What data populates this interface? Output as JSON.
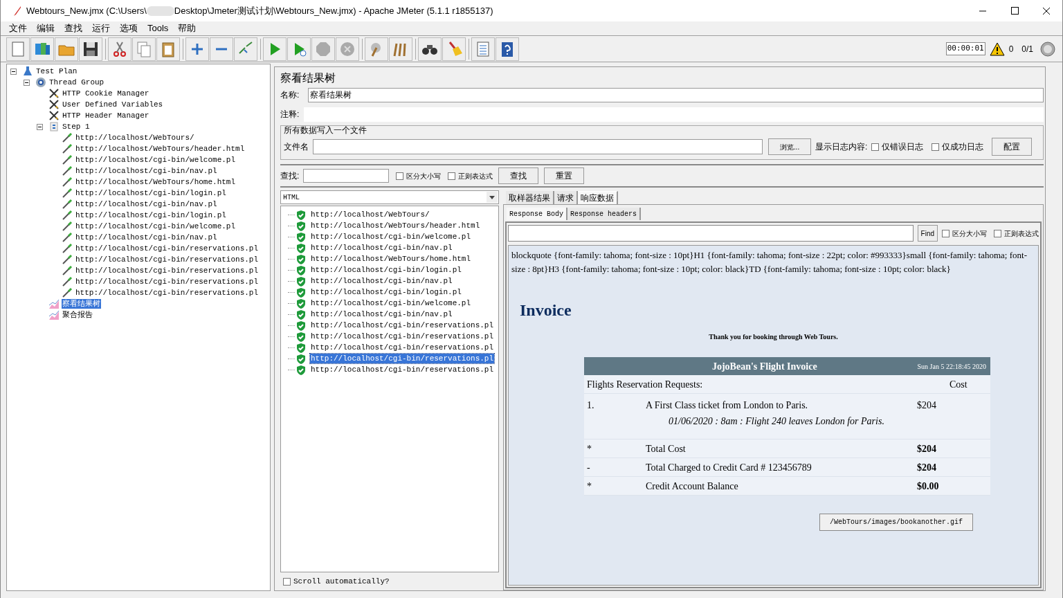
{
  "window": {
    "title_parts": [
      "Webtours_New.jmx (C:\\Users\\",
      "Desktop\\Jmeter测试计划\\Webtours_New.jmx) - Apache JMeter (5.1.1 r1855137)"
    ]
  },
  "menu": [
    "文件",
    "编辑",
    "查找",
    "运行",
    "选项",
    "Tools",
    "帮助"
  ],
  "status": {
    "timer": "00:00:01",
    "warnings": "0",
    "threads": "0/1"
  },
  "tree": [
    {
      "label": "Test Plan",
      "kind": "plan",
      "selected": false,
      "expanded": true,
      "children": [
        {
          "label": "Thread Group",
          "kind": "thread",
          "selected": false,
          "expanded": true,
          "children": [
            {
              "label": "HTTP Cookie Manager",
              "kind": "config",
              "selected": false
            },
            {
              "label": "User Defined Variables",
              "kind": "config",
              "selected": false
            },
            {
              "label": "HTTP Header Manager",
              "kind": "config",
              "selected": false
            },
            {
              "label": "Step 1",
              "kind": "controller",
              "selected": false,
              "expanded": true,
              "children": [
                {
                  "label": "http://localhost/WebTours/",
                  "kind": "sampler",
                  "selected": false
                },
                {
                  "label": "http://localhost/WebTours/header.html",
                  "kind": "sampler",
                  "selected": false
                },
                {
                  "label": "http://localhost/cgi-bin/welcome.pl",
                  "kind": "sampler",
                  "selected": false
                },
                {
                  "label": "http://localhost/cgi-bin/nav.pl",
                  "kind": "sampler",
                  "selected": false
                },
                {
                  "label": "http://localhost/WebTours/home.html",
                  "kind": "sampler",
                  "selected": false
                },
                {
                  "label": "http://localhost/cgi-bin/login.pl",
                  "kind": "sampler",
                  "selected": false
                },
                {
                  "label": "http://localhost/cgi-bin/nav.pl",
                  "kind": "sampler",
                  "selected": false
                },
                {
                  "label": "http://localhost/cgi-bin/login.pl",
                  "kind": "sampler",
                  "selected": false
                },
                {
                  "label": "http://localhost/cgi-bin/welcome.pl",
                  "kind": "sampler",
                  "selected": false
                },
                {
                  "label": "http://localhost/cgi-bin/nav.pl",
                  "kind": "sampler",
                  "selected": false
                },
                {
                  "label": "http://localhost/cgi-bin/reservations.pl",
                  "kind": "sampler",
                  "selected": false
                },
                {
                  "label": "http://localhost/cgi-bin/reservations.pl",
                  "kind": "sampler",
                  "selected": false
                },
                {
                  "label": "http://localhost/cgi-bin/reservations.pl",
                  "kind": "sampler",
                  "selected": false
                },
                {
                  "label": "http://localhost/cgi-bin/reservations.pl",
                  "kind": "sampler",
                  "selected": false
                },
                {
                  "label": "http://localhost/cgi-bin/reservations.pl",
                  "kind": "sampler",
                  "selected": false
                }
              ]
            },
            {
              "label": "察看结果树",
              "kind": "listener",
              "selected": true
            },
            {
              "label": "聚合报告",
              "kind": "listener",
              "selected": false
            }
          ]
        }
      ]
    }
  ],
  "panel": {
    "title": "察看结果树",
    "name_label": "名称:",
    "name_value": "察看结果树",
    "comment_label": "注释:",
    "file_group": "所有数据写入一个文件",
    "file_label": "文件名",
    "browse": "浏览...",
    "log_label": "显示日志内容:",
    "log_options": [
      {
        "label": "仅错误日志",
        "checked": false
      },
      {
        "label": "仅成功日志",
        "checked": false
      }
    ],
    "config_button": "配置"
  },
  "search": {
    "label": "查找:",
    "options": [
      {
        "label": "区分大小写",
        "checked": false
      },
      {
        "label": "正则表达式",
        "checked": false
      }
    ],
    "buttons": [
      "查找",
      "重置"
    ]
  },
  "results": {
    "renderer": "HTML",
    "items": [
      {
        "label": "http://localhost/WebTours/",
        "selected": false
      },
      {
        "label": "http://localhost/WebTours/header.html",
        "selected": false
      },
      {
        "label": "http://localhost/cgi-bin/welcome.pl",
        "selected": false
      },
      {
        "label": "http://localhost/cgi-bin/nav.pl",
        "selected": false
      },
      {
        "label": "http://localhost/WebTours/home.html",
        "selected": false
      },
      {
        "label": "http://localhost/cgi-bin/login.pl",
        "selected": false
      },
      {
        "label": "http://localhost/cgi-bin/nav.pl",
        "selected": false
      },
      {
        "label": "http://localhost/cgi-bin/login.pl",
        "selected": false
      },
      {
        "label": "http://localhost/cgi-bin/welcome.pl",
        "selected": false
      },
      {
        "label": "http://localhost/cgi-bin/nav.pl",
        "selected": false
      },
      {
        "label": "http://localhost/cgi-bin/reservations.pl",
        "selected": false
      },
      {
        "label": "http://localhost/cgi-bin/reservations.pl",
        "selected": false
      },
      {
        "label": "http://localhost/cgi-bin/reservations.pl",
        "selected": false
      },
      {
        "label": "http://localhost/cgi-bin/reservations.pl",
        "selected": true
      },
      {
        "label": "http://localhost/cgi-bin/reservations.pl",
        "selected": false
      }
    ],
    "scroll_auto": {
      "label": "Scroll automatically?",
      "checked": false
    }
  },
  "tabs": [
    {
      "label": "取样器结果",
      "selected": false
    },
    {
      "label": "请求",
      "selected": false
    },
    {
      "label": "响应数据",
      "selected": true
    }
  ],
  "subtabs": [
    {
      "label": "Response Body",
      "selected": true
    },
    {
      "label": "Response headers",
      "selected": false
    }
  ],
  "response_search": {
    "button": "Find",
    "options": [
      {
        "label": "区分大小写",
        "checked": false
      },
      {
        "label": "正则表达式",
        "checked": false
      }
    ]
  },
  "response": {
    "css_text": "blockquote {font-family: tahoma; font-size : 10pt}H1 {font-family: tahoma; font-size : 22pt; color: #993333}small {font-family: tahoma; font-size : 8pt}H3 {font-family: tahoma; font-size : 10pt; color: black}TD {font-family: tahoma; font-size : 10pt; color: black}",
    "heading": "Invoice",
    "thanks": "Thank you for booking through Web Tours.",
    "invoice": {
      "title": "JojoBean's Flight Invoice",
      "date": "Sun Jan 5 22:18:45 2020",
      "header": [
        "Flights Reservation Requests:",
        "Cost"
      ],
      "rows": [
        {
          "kind": "flight",
          "mark": "1.",
          "desc": "A First Class ticket from London to Paris.",
          "detail": "01/06/2020 : 8am : Flight 240 leaves London for Paris.",
          "cost": "$204"
        },
        {
          "kind": "total",
          "mark": "*",
          "desc": "Total Cost",
          "cost": "$204"
        },
        {
          "kind": "total",
          "mark": "-",
          "desc": "Total Charged to Credit Card # 123456789",
          "cost": "$204"
        },
        {
          "kind": "total",
          "mark": "*",
          "desc": "Credit Account Balance",
          "cost": "$0.00"
        }
      ]
    },
    "image_alt": "/WebTours/images/bookanother.gif"
  }
}
